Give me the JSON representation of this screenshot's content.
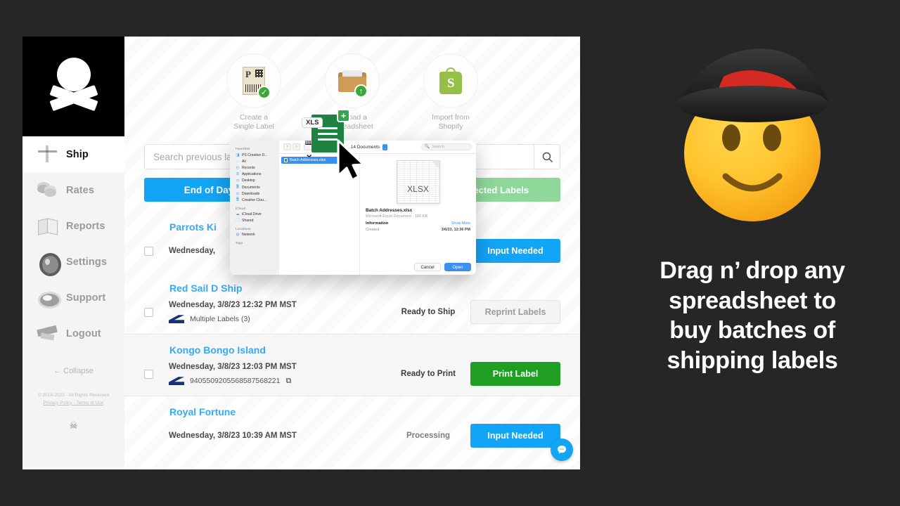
{
  "app": {
    "sidebar": {
      "logo_name": "skull-and-crossbones-logo",
      "items": [
        {
          "label": "Ship",
          "icon": "box-icon",
          "active": true
        },
        {
          "label": "Rates",
          "icon": "coins-icon",
          "active": false
        },
        {
          "label": "Reports",
          "icon": "book-icon",
          "active": false
        },
        {
          "label": "Settings",
          "icon": "ship-wheel-icon",
          "active": false
        },
        {
          "label": "Support",
          "icon": "life-ring-icon",
          "active": false
        },
        {
          "label": "Logout",
          "icon": "gangplank-icon",
          "active": false
        }
      ],
      "collapse_label": "← Collapse",
      "copyright": "© 2014-2023 - All Rights Reserved",
      "legal_links": "Privacy Policy - Terms of Use",
      "footer_mark": "☠"
    },
    "quick_actions": [
      {
        "line1": "Create a",
        "line2": "Single Label",
        "icon": "shipping-label-icon",
        "badge": "✓"
      },
      {
        "line1": "Upload a",
        "line2": "Spreadsheet",
        "icon": "folder-upload-icon",
        "badge": "↑"
      },
      {
        "line1": "Import from",
        "line2": "Shopify",
        "icon": "shopify-bag-icon",
        "badge": ""
      }
    ],
    "search": {
      "placeholder": "Search previous labels",
      "value": "",
      "button_icon": "search-icon"
    },
    "actions": {
      "end_of_day_label": "End of Day",
      "selected_labels_label": "Selected Labels"
    },
    "shipments": [
      {
        "title": "Parrots Ki",
        "date": "Wednesday,",
        "tracking": "",
        "status": "",
        "button": "Input Needed",
        "button_kind": "input",
        "alt": false
      },
      {
        "title": "Red Sail D Ship",
        "date": "Wednesday, 3/8/23 12:32 PM MST",
        "tracking": "Multiple Labels (3)",
        "status": "Ready to Ship",
        "button": "Reprint Labels",
        "button_kind": "reprint",
        "alt": false
      },
      {
        "title": "Kongo Bongo Island",
        "date": "Wednesday, 3/8/23 12:03 PM MST",
        "tracking": "9405509205568587568221",
        "status": "Ready to Print",
        "button": "Print Label",
        "button_kind": "print",
        "alt": true
      },
      {
        "title": "Royal Fortune",
        "date": "Wednesday, 3/8/23 10:39 AM MST",
        "tracking": "",
        "status": "Processing",
        "button": "Input Needed",
        "button_kind": "input",
        "alt": false
      }
    ],
    "chat_icon": "chat-bubble-icon"
  },
  "file_dialog": {
    "sidebar_groups": [
      {
        "title": "Favorites",
        "items": [
          {
            "label": "PS Creative D...",
            "icon": "photoshop-icon"
          },
          {
            "label": "Air",
            "icon": "airdrop-icon"
          },
          {
            "label": "Recents",
            "icon": "clock-icon"
          },
          {
            "label": "Applications",
            "icon": "applications-icon"
          },
          {
            "label": "Desktop",
            "icon": "desktop-icon"
          },
          {
            "label": "Documents",
            "icon": "document-icon"
          },
          {
            "label": "Downloads",
            "icon": "downloads-icon"
          },
          {
            "label": "Creative Clou...",
            "icon": "document-icon"
          }
        ]
      },
      {
        "title": "iCloud",
        "items": [
          {
            "label": "iCloud Drive",
            "icon": "cloud-icon"
          },
          {
            "label": "Shared",
            "icon": "shared-folder-icon"
          }
        ]
      },
      {
        "title": "Locations",
        "items": [
          {
            "label": "Network",
            "icon": "network-icon"
          }
        ]
      },
      {
        "title": "Tags",
        "items": []
      }
    ],
    "toolbar": {
      "back_icon": "chevron-left-icon",
      "forward_icon": "chevron-right-icon",
      "view_icon": "grid-view-icon",
      "path_label": "14 Documents",
      "search_placeholder": "Search",
      "search_icon": "search-icon"
    },
    "file_list": [
      {
        "name": "Batch Addresses.xlsx",
        "selected": true
      }
    ],
    "preview": {
      "thumb_label": "XLSX",
      "name": "Batch Addresses.xlsx",
      "subtitle": "Microsoft Excel Document - 166 KB",
      "info_title": "Information",
      "show_more": "Show More",
      "created_key": "Created",
      "created_value": "3/6/23, 12:36 PM"
    },
    "buttons": {
      "cancel": "Cancel",
      "open": "Open"
    }
  },
  "drag_ghost": {
    "tag": "XLS",
    "plus": "+",
    "name": "xls-file-drag-ghost"
  },
  "promo": {
    "emoji_name": "pirate-smiley-emoji",
    "headline_lines": [
      "Drag n’ drop any",
      "spreadsheet to",
      "buy batches of",
      "shipping labels"
    ]
  },
  "colors": {
    "accent_blue": "#12a4f5",
    "accent_green": "#1f9e21",
    "soft_green": "#8ed89a",
    "dark_bg": "#262626",
    "link_blue": "#39a9f4"
  }
}
